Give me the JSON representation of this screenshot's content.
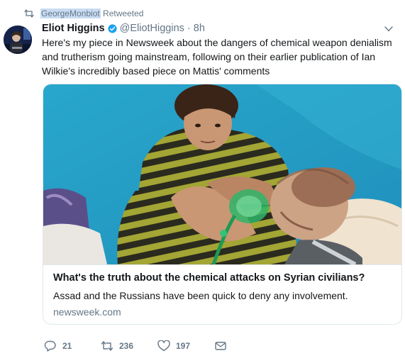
{
  "retweet": {
    "icon": "retweet-icon",
    "user": "GeorgeMonbiot",
    "suffix": " Retweeted"
  },
  "tweet": {
    "author_name": "Eliot Higgins",
    "verified_icon": "verified-badge-icon",
    "handle": "@EliotHiggins",
    "separator": "·",
    "time": "8h",
    "text": "Here's my piece in Newsweek about the dangers of chemical weapon denialism and trutherism going mainstream, following on their earlier publication of Ian Wilkie's incredibly based piece on Mattis' comments"
  },
  "card": {
    "title": "What's the truth about the chemical attacks on Syrian civilians?",
    "description": "Assad and the Russians have been quick to deny any involvement.",
    "domain": "newsweek.com"
  },
  "actions": {
    "reply_count": "21",
    "retweet_count": "236",
    "like_count": "197"
  },
  "colors": {
    "accent": "#1da1f2",
    "muted": "#657786",
    "text": "#14171a",
    "border": "#e1e8ed"
  }
}
